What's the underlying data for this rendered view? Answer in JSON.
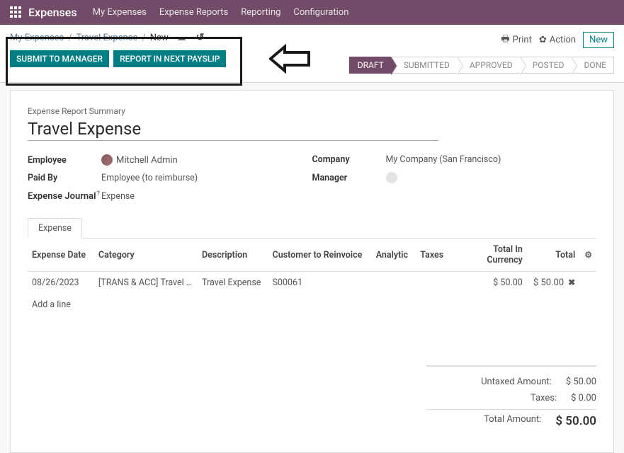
{
  "topbar": {
    "title": "Expenses",
    "links": [
      "My Expenses",
      "Expense Reports",
      "Reporting",
      "Configuration"
    ]
  },
  "breadcrumb": {
    "a": "My Expenses",
    "b": "Travel Expense",
    "c": "New"
  },
  "buttons": {
    "submit": "SUBMIT TO MANAGER",
    "payslip": "REPORT IN NEXT PAYSLIP"
  },
  "actions": {
    "print": "Print",
    "action": "Action",
    "new": "New"
  },
  "status": [
    "DRAFT",
    "SUBMITTED",
    "APPROVED",
    "POSTED",
    "DONE"
  ],
  "sheet": {
    "summary_label": "Expense Report Summary",
    "title": "Travel Expense",
    "employee_label": "Employee",
    "employee": "Mitchell Admin",
    "paidby_label": "Paid By",
    "paidby": "Employee (to reimburse)",
    "journal_label": "Expense Journal",
    "journal": "Expense",
    "company_label": "Company",
    "company": "My Company (San Francisco)",
    "manager_label": "Manager"
  },
  "tabs": {
    "expense": "Expense"
  },
  "columns": {
    "date": "Expense Date",
    "cat": "Category",
    "desc": "Description",
    "cust": "Customer to Reinvoice",
    "anal": "Analytic",
    "tax": "Taxes",
    "tic": "Total In Currency",
    "tot": "Total"
  },
  "row": {
    "date": "08/26/2023",
    "cat": "[TRANS & ACC] Travel & ...",
    "desc": "Travel Expense",
    "cust": "S00061",
    "anal": "",
    "tax": "",
    "tic": "$ 50.00",
    "tot": "$ 50.00"
  },
  "add_line": "Add a line",
  "totals": {
    "untaxed_label": "Untaxed Amount:",
    "untaxed": "$ 50.00",
    "taxes_label": "Taxes:",
    "taxes": "$ 0.00",
    "total_label": "Total Amount:",
    "total": "$ 50.00"
  }
}
